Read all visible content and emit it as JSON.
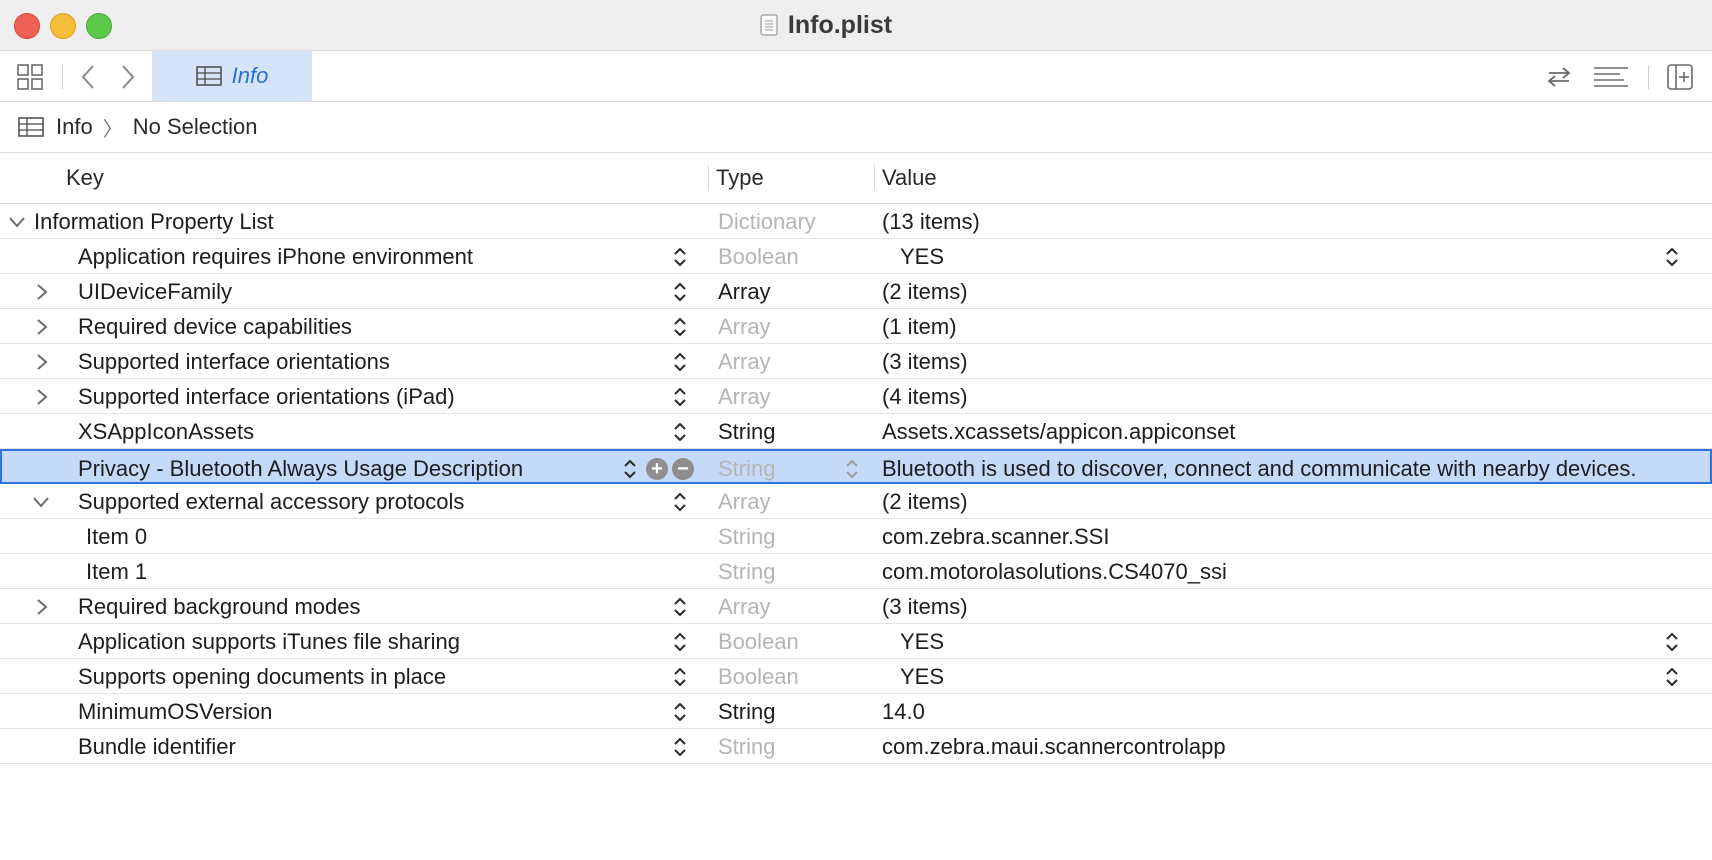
{
  "window": {
    "title": "Info.plist"
  },
  "toolbar": {
    "tab_label": "Info"
  },
  "breadcrumb": {
    "root": "Info",
    "separator": "〉",
    "current": "No Selection"
  },
  "columns": {
    "key": "Key",
    "type": "Type",
    "value": "Value"
  },
  "root_row": {
    "key": "Information Property List",
    "type": "Dictionary",
    "value": "(13 items)"
  },
  "rows": [
    {
      "key": "Application requires iPhone environment",
      "type": "Boolean",
      "value": "YES"
    },
    {
      "key": "UIDeviceFamily",
      "type": "Array",
      "value": "(2 items)"
    },
    {
      "key": "Required device capabilities",
      "type": "Array",
      "value": "(1 item)"
    },
    {
      "key": "Supported interface orientations",
      "type": "Array",
      "value": "(3 items)"
    },
    {
      "key": "Supported interface orientations (iPad)",
      "type": "Array",
      "value": "(4 items)"
    },
    {
      "key": "XSAppIconAssets",
      "type": "String",
      "value": "Assets.xcassets/appicon.appiconset"
    },
    {
      "key": "Privacy - Bluetooth Always Usage Description",
      "type": "String",
      "value": "Bluetooth is used to discover, connect and communicate with nearby devices."
    },
    {
      "key": "Supported external accessory protocols",
      "type": "Array",
      "value": "(2 items)"
    },
    {
      "key": "Item 0",
      "type": "String",
      "value": "com.zebra.scanner.SSI"
    },
    {
      "key": "Item 1",
      "type": "String",
      "value": "com.motorolasolutions.CS4070_ssi"
    },
    {
      "key": "Required background modes",
      "type": "Array",
      "value": "(3 items)"
    },
    {
      "key": "Application supports iTunes file sharing",
      "type": "Boolean",
      "value": "YES"
    },
    {
      "key": "Supports opening documents in place",
      "type": "Boolean",
      "value": "YES"
    },
    {
      "key": "MinimumOSVersion",
      "type": "String",
      "value": "14.0"
    },
    {
      "key": "Bundle identifier",
      "type": "String",
      "value": "com.zebra.maui.scannercontrolapp"
    }
  ],
  "colors": {
    "selection_bg": "#c4daf8",
    "selection_border": "#3173db",
    "tab_active_bg": "#d5e4f9",
    "accent": "#2a6fd6"
  }
}
